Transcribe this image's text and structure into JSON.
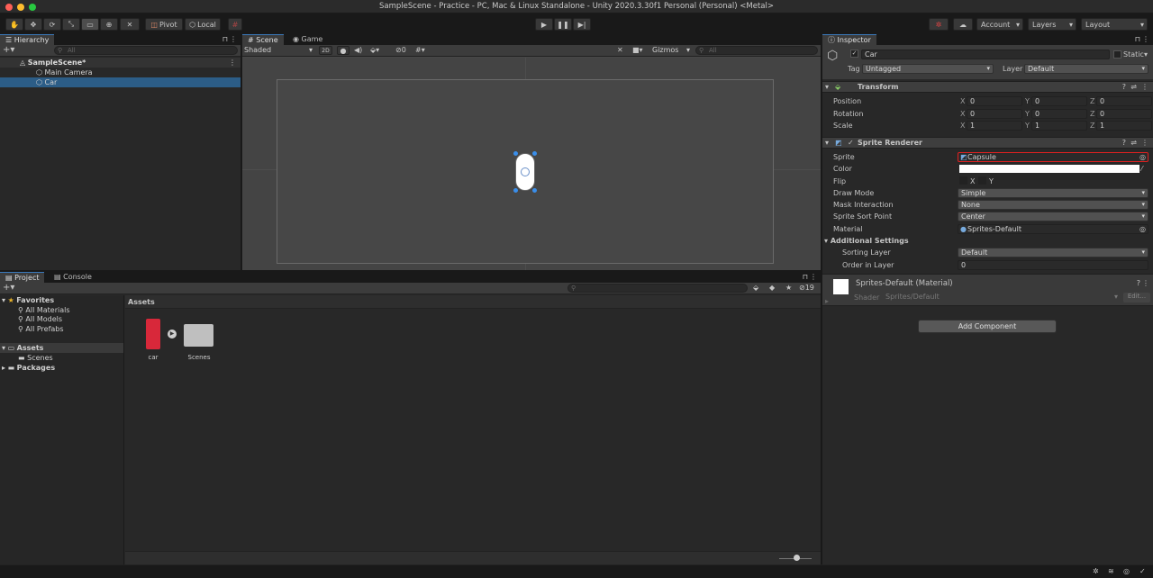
{
  "window": {
    "title": "SampleScene - Practice - PC, Mac & Linux Standalone - Unity 2020.3.30f1 Personal (Personal) <Metal>"
  },
  "toolbar": {
    "pivot": "Pivot",
    "local": "Local",
    "account": "Account",
    "layers": "Layers",
    "layout": "Layout"
  },
  "hierarchy": {
    "tab": "Hierarchy",
    "search_placeholder": "All",
    "scene": "SampleScene*",
    "items": [
      "Main Camera",
      "Car"
    ]
  },
  "scene": {
    "tab_scene": "Scene",
    "tab_game": "Game",
    "shading": "Shaded",
    "mode_2d": "2D",
    "hidden_count": "0",
    "gizmos": "Gizmos",
    "search_placeholder": "All"
  },
  "inspector": {
    "tab": "Inspector",
    "object_name": "Car",
    "static": "Static",
    "tag_label": "Tag",
    "tag_value": "Untagged",
    "layer_label": "Layer",
    "layer_value": "Default",
    "transform": {
      "title": "Transform",
      "labels": [
        "Position",
        "Rotation",
        "Scale"
      ],
      "x": [
        "0",
        "0",
        "1"
      ],
      "y": [
        "0",
        "0",
        "1"
      ],
      "z": [
        "0",
        "0",
        "1"
      ]
    },
    "sprite_renderer": {
      "title": "Sprite Renderer",
      "sprite_label": "Sprite",
      "sprite_value": "Capsule",
      "color_label": "Color",
      "flip_label": "Flip",
      "flip_x": "X",
      "flip_y": "Y",
      "draw_mode_label": "Draw Mode",
      "draw_mode": "Simple",
      "mask_label": "Mask Interaction",
      "mask": "None",
      "sort_point_label": "Sprite Sort Point",
      "sort_point": "Center",
      "material_label": "Material",
      "material": "Sprites-Default",
      "additional": "Additional Settings",
      "sorting_layer_label": "Sorting Layer",
      "sorting_layer": "Default",
      "order_label": "Order in Layer",
      "order": "0"
    },
    "material": {
      "name": "Sprites-Default (Material)",
      "shader_label": "Shader",
      "shader": "Sprites/Default",
      "edit": "Edit..."
    },
    "add_component": "Add Component"
  },
  "project": {
    "tab_project": "Project",
    "tab_console": "Console",
    "hidden_count": "19",
    "favorites": "Favorites",
    "fav_items": [
      "All Materials",
      "All Models",
      "All Prefabs"
    ],
    "assets": "Assets",
    "scenes": "Scenes",
    "packages": "Packages",
    "breadcrumb": "Assets",
    "files": [
      "car",
      "Scenes"
    ]
  },
  "colors": {
    "selection": "#2c5d87",
    "highlight_border": "#e02020",
    "panel": "#282828",
    "gizmo_blue": "#3a8eea"
  }
}
